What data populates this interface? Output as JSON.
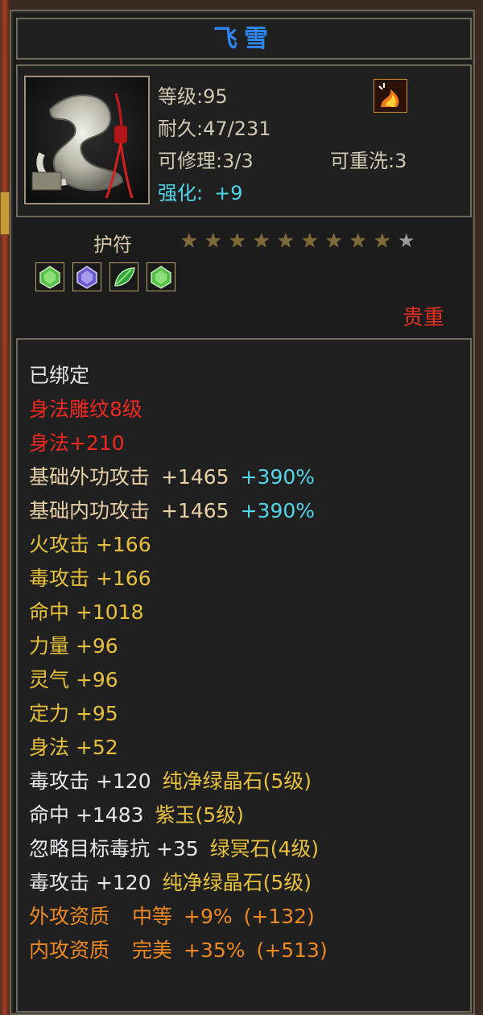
{
  "item": {
    "name": "飞雪",
    "level": "等级:95",
    "durability": "耐久:47/231",
    "repairable": "可修理:3/3",
    "rewashable": "可重洗:3",
    "enhance_label": "强化:",
    "enhance_value": "+9",
    "type": "护符",
    "stars_total": 10,
    "stars_filled": 9,
    "rarity": "贵重"
  },
  "gems": [
    {
      "icon": "green-crystal-gem-icon",
      "color": "#55c04a"
    },
    {
      "icon": "purple-jade-gem-icon",
      "color": "#7a6ad8"
    },
    {
      "icon": "green-leaf-gem-icon",
      "color": "#2ea43a"
    },
    {
      "icon": "green-crystal-gem-icon",
      "color": "#55c04a"
    }
  ],
  "attributes": {
    "bound": "已绑定",
    "engrave": "身法雕纹8级",
    "engrave_bonus": "身法+210",
    "ext_attack_label": "基础外功攻击",
    "ext_attack_value": "+1465",
    "ext_attack_pct": "+390%",
    "int_attack_label": "基础内功攻击",
    "int_attack_value": "+1465",
    "int_attack_pct": "+390%",
    "fire_attack": "火攻击 +166",
    "poison_attack": "毒攻击 +166",
    "hit": "命中 +1018",
    "strength": "力量 +96",
    "spirit": "灵气 +96",
    "focus": "定力 +95",
    "agility": "身法 +52"
  },
  "gem_bonuses": [
    {
      "stat": "毒攻击 +120",
      "gem": "纯净绿晶石(5级)"
    },
    {
      "stat": "命中 +1483",
      "gem": "紫玉(5级)"
    },
    {
      "stat": "忽略目标毒抗 +35",
      "gem": "绿冥石(4级)"
    },
    {
      "stat": "毒攻击 +120",
      "gem": "纯净绿晶石(5级)"
    }
  ],
  "qualities": [
    {
      "label": "外攻资质",
      "grade": "中等",
      "pct": "+9%",
      "value": "(+132)"
    },
    {
      "label": "内攻资质",
      "grade": "完美",
      "pct": "+35%",
      "value": "(+513)"
    }
  ],
  "colors": {
    "title": "#2f86f0",
    "bound": "#e3e6ea",
    "engrave": "#ee2a20",
    "base_attack": "#e7d0a6",
    "percent": "#52d7e8",
    "stat": "#e7c03c",
    "quality": "#ef8a22",
    "rarity": "#e43323"
  }
}
